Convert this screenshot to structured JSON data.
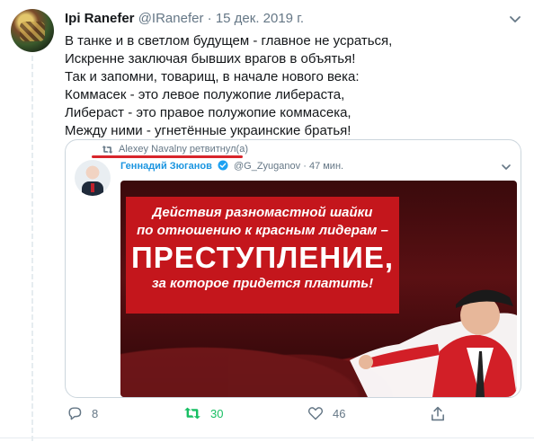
{
  "tweet": {
    "author_name": "Ipi Ranefer",
    "author_handle": "@IRanefer",
    "dot": "·",
    "date": "15 дек. 2019 г.",
    "lines": [
      "В танке и в светлом будущем - главное не усраться,",
      "Искренне заключая бывших врагов в объятья!",
      "Так и запомни, товарищ, в начале нового века:",
      "Коммасек - это левое полужопие либераста,",
      "Либераст - это правое полужопие коммасека,",
      "Между ними - угнетённые украинские братья!"
    ]
  },
  "retweet_label": "Alexey Navalny ретвитнул(а)",
  "quote": {
    "name": "Геннадий Зюганов",
    "handle": "@G_Zyuganov",
    "dot": "·",
    "time": "47 мин.",
    "image_text": {
      "line1": "Действия разномастной шайки",
      "line2": "по отношению к красным лидерам –",
      "line3": "ПРЕСТУПЛЕНИЕ,",
      "line4": "за которое придется платить!"
    }
  },
  "actions": {
    "replies": "8",
    "retweets": "30",
    "likes": "46"
  },
  "colors": {
    "accent_blue": "#1b95e0",
    "retweet_green": "#17bf63",
    "muted": "#657786",
    "banner_red": "#c4161c"
  },
  "icons": [
    "chevron-down-icon",
    "retweet-icon",
    "verified-badge-icon",
    "reply-icon",
    "like-icon",
    "share-icon"
  ]
}
